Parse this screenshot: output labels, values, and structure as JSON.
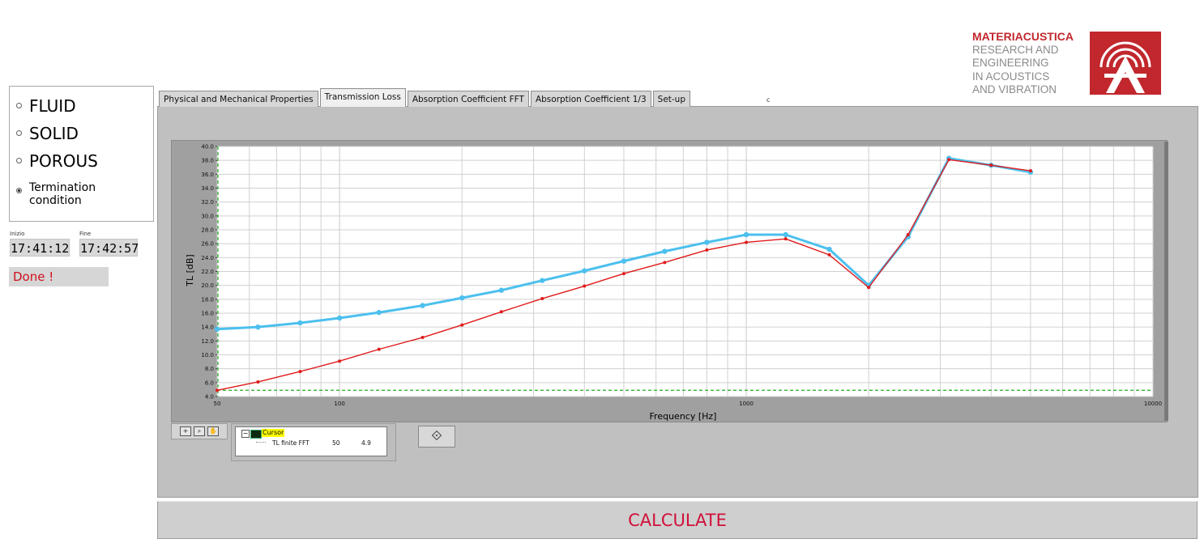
{
  "logo": {
    "title": "MATERIACUSTICA",
    "lines": [
      "RESEARCH AND",
      "ENGINEERING",
      "IN ACOUSTICS",
      "AND VIBRATION"
    ]
  },
  "radio": {
    "options": [
      {
        "label": "FLUID",
        "selected": false
      },
      {
        "label": "SOLID",
        "selected": false
      },
      {
        "label": "POROUS",
        "selected": false
      },
      {
        "label": "Termination condition",
        "selected": true
      }
    ]
  },
  "timer": {
    "start_label": "Inizio",
    "start_value": "17:41:12",
    "end_label": "Fine",
    "end_value": "17:42:57"
  },
  "status": "Done !",
  "tabs": [
    {
      "label": "Physical and Mechanical Properties",
      "active": false
    },
    {
      "label": "Transmission Loss",
      "active": true
    },
    {
      "label": "Absorption Coefficient FFT",
      "active": false
    },
    {
      "label": "Absorption Coefficient 1/3",
      "active": false
    },
    {
      "label": "Set-up",
      "active": false
    }
  ],
  "stray_char": "c",
  "cursor": {
    "title": "Cursor",
    "name": "TL finite FFT",
    "x": "50",
    "y": "4.9"
  },
  "calculate_label": "CALCULATE",
  "colors": {
    "series_blue": "#4cc0ee",
    "series_red": "#e01a1a",
    "cursor_line": "#22aa22",
    "accent_red": "#c1272d"
  },
  "chart_data": {
    "type": "line",
    "xlabel": "Frequency [Hz]",
    "ylabel": "TL [dB]",
    "x_scale": "log",
    "xlim": [
      50,
      10000
    ],
    "ylim": [
      4,
      40
    ],
    "x_tick_labels": [
      "50",
      "100",
      "1000",
      "10000"
    ],
    "y_tick_labels": [
      "4.0",
      "6.0",
      "8.0",
      "10.0",
      "12.0",
      "14.0",
      "16.0",
      "18.0",
      "20.0",
      "22.0",
      "24.0",
      "26.0",
      "28.0",
      "30.0",
      "32.0",
      "34.0",
      "36.0",
      "38.0",
      "40.0"
    ],
    "grid": true,
    "cursor_hline_y": 4.9,
    "series": [
      {
        "color": "#4cc0ee",
        "x": [
          50,
          63,
          80,
          100,
          125,
          160,
          200,
          250,
          315,
          400,
          500,
          630,
          800,
          1000,
          1250,
          1600,
          2000,
          2500,
          3150,
          4000,
          5000
        ],
        "y": [
          13.7,
          14.0,
          14.6,
          15.3,
          16.1,
          17.1,
          18.2,
          19.3,
          20.7,
          22.1,
          23.5,
          24.9,
          26.2,
          27.3,
          27.3,
          25.2,
          20.0,
          27.0,
          38.3,
          37.3,
          36.3
        ]
      },
      {
        "color": "#e01a1a",
        "x": [
          50,
          63,
          80,
          100,
          125,
          160,
          200,
          250,
          315,
          400,
          500,
          630,
          800,
          1000,
          1250,
          1600,
          2000,
          2500,
          3150,
          4000,
          5000
        ],
        "y": [
          4.9,
          6.1,
          7.6,
          9.1,
          10.8,
          12.5,
          14.3,
          16.2,
          18.1,
          19.9,
          21.7,
          23.3,
          25.1,
          26.2,
          26.7,
          24.4,
          19.7,
          27.3,
          38.1,
          37.3,
          36.5
        ]
      }
    ]
  }
}
